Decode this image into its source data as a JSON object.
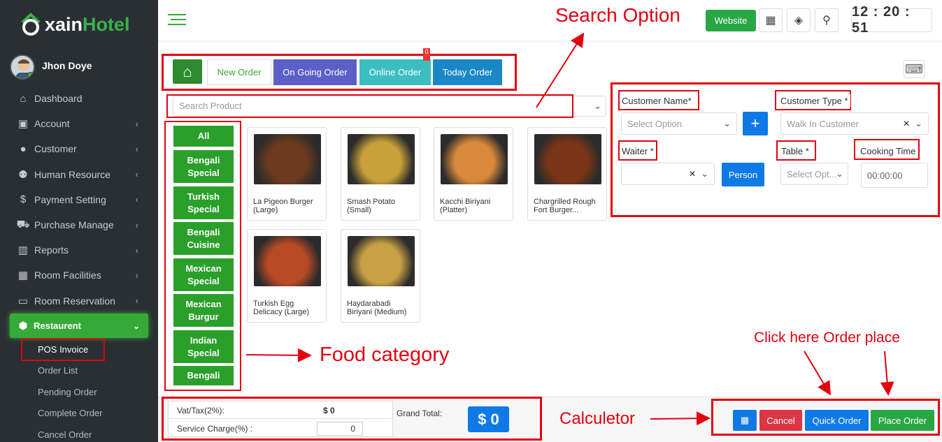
{
  "brand": {
    "logo_text_1": "xain",
    "logo_text_2": "Hotel"
  },
  "user": {
    "name": "Jhon Doye"
  },
  "sidebar": {
    "items": [
      {
        "label": "Dashboard",
        "icon": "home-icon",
        "glyph": "⌂",
        "chevron": false
      },
      {
        "label": "Account",
        "icon": "briefcase-icon",
        "glyph": "▣",
        "chevron": true
      },
      {
        "label": "Customer",
        "icon": "user-icon",
        "glyph": "●",
        "chevron": true
      },
      {
        "label": "Human Resource",
        "icon": "users-icon",
        "glyph": "⚉",
        "chevron": true
      },
      {
        "label": "Payment Setting",
        "icon": "dollar-icon",
        "glyph": "$",
        "chevron": true
      },
      {
        "label": "Purchase Manage",
        "icon": "cart-icon",
        "glyph": "⛟",
        "chevron": true
      },
      {
        "label": "Reports",
        "icon": "bar-chart-icon",
        "glyph": "▥",
        "chevron": true
      },
      {
        "label": "Room Facilities",
        "icon": "grid-icon",
        "glyph": "▦",
        "chevron": true
      },
      {
        "label": "Room Reservation",
        "icon": "tv-icon",
        "glyph": "▭",
        "chevron": true
      }
    ],
    "active": {
      "label": "Restaurent",
      "icon": "cube-icon"
    },
    "subitems": [
      "POS Invoice",
      "Order List",
      "Pending Order",
      "Complete Order",
      "Cancel Order"
    ]
  },
  "topbar": {
    "website_label": "Website",
    "clock": "12 : 20 : 51"
  },
  "tabs": {
    "new": "New Order",
    "ongoing": "On Going Order",
    "online": "Online Order",
    "today": "Today Order",
    "badge": "0"
  },
  "search": {
    "placeholder": "Search Product"
  },
  "categories": [
    "All",
    "Bengali Special",
    "Turkish Special",
    "Bengali Cuisine",
    "Mexican Special",
    "Mexican Burgur",
    "Indian Special",
    "Bengali"
  ],
  "products": [
    {
      "name": "La Pigeon Burger (Large)",
      "color": "#6b3a1f"
    },
    {
      "name": "Smash Potato (Small)",
      "color": "#c9a13a"
    },
    {
      "name": "Kacchi Biriyani (Platter)",
      "color": "#d8893b"
    },
    {
      "name": "Chargrilled Rough Fort Burger...",
      "color": "#7a3418"
    },
    {
      "name": "Turkish Egg Delicacy (Large)",
      "color": "#b84a26"
    },
    {
      "name": "Haydarabadi Biriyani (Medium)",
      "color": "#c8a046"
    }
  ],
  "form": {
    "customer_name_label": "Customer Name*",
    "customer_name_placeholder": "Select Option",
    "customer_type_label": "Customer Type *",
    "customer_type_value": "Walk In Customer",
    "waiter_label": "Waiter *",
    "person_label": "Person",
    "table_label": "Table *",
    "table_placeholder": "Select Opt...",
    "cooking_label": "Cooking Time",
    "cooking_value": "00:00:00"
  },
  "footer": {
    "vat_label": "Vat/Tax(2%):",
    "vat_value": "$ 0",
    "service_label": "Service Charge(%) :",
    "service_value": "0",
    "grand_label": "Grand Total:",
    "grand_value": "$ 0",
    "cancel": "Cancel",
    "quick": "Quick Order",
    "place": "Place Order"
  },
  "annotations": {
    "search": "Search Option",
    "food": "Food category",
    "order": "Click here Order place",
    "calc": "Calculetor"
  },
  "colors": {
    "accent": "#37a93a",
    "annotation": "#e3000f",
    "blue": "#0f7ae5"
  }
}
